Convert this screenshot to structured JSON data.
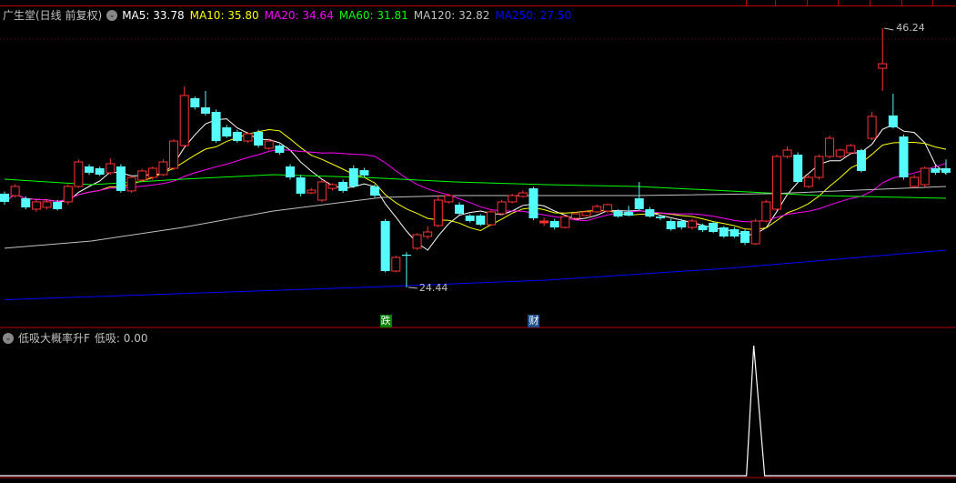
{
  "header": {
    "title": "广生堂(日线 前复权)",
    "ma": [
      {
        "label": "MA5: 33.78",
        "color": "#ffffff"
      },
      {
        "label": "MA10: 35.80",
        "color": "#ffff00"
      },
      {
        "label": "MA20: 34.64",
        "color": "#ff00ff"
      },
      {
        "label": "MA60: 31.81",
        "color": "#00ff00"
      },
      {
        "label": "MA120: 32.82",
        "color": "#c0c0c0"
      },
      {
        "label": "MA250: 27.50",
        "color": "#0000ff"
      }
    ]
  },
  "indicator": {
    "name": "低吸大概率升F",
    "value_label": "低吸: 0.00",
    "spike_index": 71
  },
  "markers": [
    {
      "text": "跌",
      "index": 36,
      "color": "#008000"
    },
    {
      "text": "财",
      "index": 50,
      "color": "#1e4f8a"
    }
  ],
  "price_labels": {
    "high": "46.24",
    "low": "24.44",
    "high_value": 46.24,
    "low_value": 24.44,
    "high_index": 83,
    "low_index": 38
  },
  "colors": {
    "up": "#ff3333",
    "down": "#54fcfc",
    "separator": "#c00000"
  },
  "chart_data": {
    "type": "candlestick",
    "price_range": [
      24.44,
      46.24
    ],
    "candles": [
      [
        32.32,
        31.63,
        32.5,
        31.4
      ],
      [
        32.16,
        32.93,
        33.1,
        32.0
      ],
      [
        31.93,
        31.17,
        32.1,
        31.0
      ],
      [
        31.02,
        31.63,
        31.8,
        30.8
      ],
      [
        31.17,
        31.63,
        31.8,
        31.0
      ],
      [
        31.63,
        31.02,
        31.8,
        30.9
      ],
      [
        31.63,
        32.93,
        33.1,
        31.4
      ],
      [
        32.93,
        34.99,
        35.2,
        32.8
      ],
      [
        34.61,
        34.08,
        34.8,
        33.9
      ],
      [
        34.46,
        33.92,
        34.6,
        33.8
      ],
      [
        34.08,
        34.84,
        35.3,
        33.9
      ],
      [
        34.61,
        32.55,
        34.8,
        32.4
      ],
      [
        32.55,
        33.69,
        33.9,
        32.4
      ],
      [
        33.46,
        34.23,
        34.4,
        33.3
      ],
      [
        33.69,
        34.46,
        34.6,
        33.5
      ],
      [
        33.92,
        34.99,
        35.2,
        33.8
      ],
      [
        34.46,
        36.75,
        36.9,
        34.3
      ],
      [
        36.37,
        40.58,
        41.34,
        36.2
      ],
      [
        40.35,
        39.58,
        40.5,
        39.4
      ],
      [
        39.58,
        39.05,
        40.96,
        38.9
      ],
      [
        39.2,
        36.75,
        39.4,
        36.6
      ],
      [
        37.9,
        37.13,
        38.1,
        37.0
      ],
      [
        37.52,
        36.75,
        37.7,
        36.6
      ],
      [
        36.75,
        37.36,
        37.5,
        36.6
      ],
      [
        37.52,
        36.37,
        37.7,
        36.2
      ],
      [
        36.14,
        36.75,
        36.9,
        36.0
      ],
      [
        36.37,
        35.76,
        36.5,
        35.6
      ],
      [
        34.61,
        33.69,
        34.8,
        33.5
      ],
      [
        33.69,
        32.32,
        33.9,
        32.1
      ],
      [
        32.39,
        32.62,
        32.8,
        32.3
      ],
      [
        31.78,
        33.31,
        33.5,
        31.6
      ],
      [
        32.77,
        33.08,
        33.2,
        32.6
      ],
      [
        33.31,
        32.55,
        33.5,
        32.4
      ],
      [
        34.46,
        32.93,
        34.7,
        32.8
      ],
      [
        34.3,
        33.85,
        34.5,
        33.7
      ],
      [
        32.93,
        32.16,
        33.1,
        32.0
      ],
      [
        30.02,
        25.81,
        30.2,
        25.7
      ],
      [
        25.81,
        26.96,
        27.1,
        25.7
      ],
      [
        27.19,
        27.1,
        27.4,
        24.44
      ],
      [
        27.73,
        28.87,
        29.0,
        27.6
      ],
      [
        28.72,
        29.1,
        29.6,
        28.5
      ],
      [
        29.64,
        31.78,
        32.2,
        29.5
      ],
      [
        31.63,
        32.16,
        32.3,
        31.5
      ],
      [
        31.4,
        30.63,
        31.6,
        30.5
      ],
      [
        30.48,
        30.02,
        30.6,
        29.9
      ],
      [
        30.48,
        29.71,
        30.6,
        29.6
      ],
      [
        29.71,
        30.79,
        31.0,
        29.6
      ],
      [
        30.63,
        31.63,
        31.8,
        30.5
      ],
      [
        31.63,
        32.16,
        32.3,
        31.5
      ],
      [
        32.09,
        32.39,
        32.6,
        32.0
      ],
      [
        32.77,
        30.25,
        32.9,
        30.1
      ],
      [
        29.87,
        30.02,
        30.3,
        29.6
      ],
      [
        30.02,
        29.48,
        30.2,
        29.3
      ],
      [
        29.48,
        30.4,
        30.5,
        29.4
      ],
      [
        30.25,
        30.63,
        30.8,
        30.1
      ],
      [
        30.48,
        30.79,
        30.9,
        30.4
      ],
      [
        30.79,
        31.24,
        31.4,
        30.7
      ],
      [
        30.86,
        31.4,
        31.5,
        30.7
      ],
      [
        30.86,
        30.4,
        31.0,
        30.3
      ],
      [
        30.79,
        30.48,
        31.3,
        30.4
      ],
      [
        31.93,
        31.02,
        33.31,
        30.9
      ],
      [
        31.02,
        30.4,
        31.2,
        30.3
      ],
      [
        30.4,
        30.25,
        30.5,
        30.1
      ],
      [
        30.02,
        29.33,
        30.2,
        29.2
      ],
      [
        30.02,
        29.48,
        30.2,
        29.3
      ],
      [
        29.48,
        30.02,
        30.2,
        29.3
      ],
      [
        29.64,
        29.25,
        29.8,
        29.1
      ],
      [
        29.87,
        29.1,
        30.0,
        29.0
      ],
      [
        29.48,
        28.72,
        29.6,
        28.6
      ],
      [
        29.33,
        28.72,
        29.5,
        28.6
      ],
      [
        29.18,
        28.18,
        29.3,
        28.0
      ],
      [
        28.11,
        30.02,
        30.2,
        28.0
      ],
      [
        30.02,
        31.63,
        31.8,
        29.9
      ],
      [
        31.02,
        35.45,
        35.6,
        30.9
      ],
      [
        35.45,
        35.99,
        36.3,
        35.3
      ],
      [
        35.6,
        33.31,
        35.8,
        33.2
      ],
      [
        32.93,
        33.69,
        33.9,
        32.8
      ],
      [
        33.69,
        35.45,
        35.6,
        33.5
      ],
      [
        35.45,
        36.98,
        37.2,
        35.3
      ],
      [
        35.45,
        35.99,
        36.1,
        35.3
      ],
      [
        35.76,
        36.37,
        36.5,
        35.6
      ],
      [
        35.99,
        34.23,
        36.1,
        34.1
      ],
      [
        36.98,
        38.82,
        39.2,
        36.8
      ],
      [
        42.87,
        43.25,
        46.24,
        40.96
      ],
      [
        38.9,
        37.9,
        40.73,
        37.8
      ],
      [
        37.13,
        33.69,
        37.3,
        33.5
      ],
      [
        32.93,
        33.69,
        33.9,
        32.8
      ],
      [
        33.08,
        34.46,
        34.6,
        32.9
      ],
      [
        34.46,
        34.08,
        34.7,
        33.9
      ],
      [
        34.46,
        34.08,
        35.2,
        33.9
      ]
    ],
    "ma_long": {
      "MA60": [
        [
          0,
          33.54
        ],
        [
          8.2,
          33.08
        ],
        [
          16.8,
          33.54
        ],
        [
          25.4,
          33.92
        ],
        [
          34,
          33.69
        ],
        [
          42.6,
          33.31
        ],
        [
          51.2,
          33.08
        ],
        [
          59.8,
          32.93
        ],
        [
          68.4,
          32.55
        ],
        [
          77,
          32.16
        ],
        [
          89,
          31.93
        ]
      ],
      "MA120": [
        [
          0,
          27.73
        ],
        [
          8.2,
          28.34
        ],
        [
          16.8,
          29.48
        ],
        [
          25.4,
          30.86
        ],
        [
          35.7,
          32.01
        ],
        [
          42.6,
          32.16
        ],
        [
          51.2,
          32.16
        ],
        [
          59.8,
          32.16
        ],
        [
          72.7,
          32.32
        ],
        [
          89,
          32.93
        ]
      ],
      "MA250": [
        [
          0,
          23.4
        ],
        [
          34,
          24.44
        ],
        [
          51.2,
          25.05
        ],
        [
          68.4,
          26.04
        ],
        [
          89,
          27.57
        ]
      ]
    },
    "indicator_range": [
      0,
      1
    ]
  }
}
